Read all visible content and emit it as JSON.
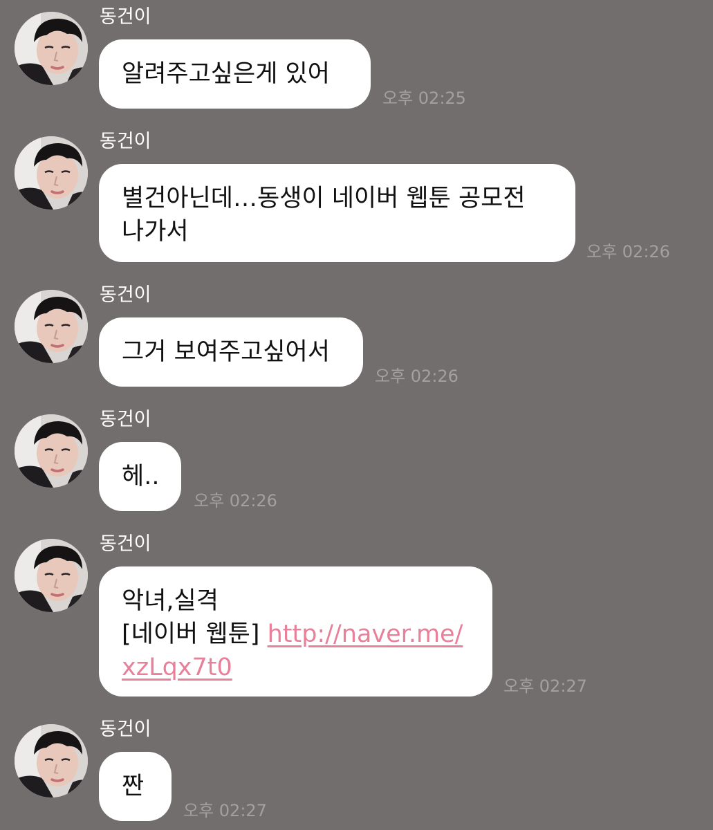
{
  "messages": [
    {
      "sender": "동건이",
      "lines": [
        "알려주고싶은게 있어"
      ],
      "time": "오후 02:25"
    },
    {
      "sender": "동건이",
      "lines": [
        "별건아닌데…동생이 네이버 웹툰 공모전",
        "나가서"
      ],
      "time": "오후 02:26"
    },
    {
      "sender": "동건이",
      "lines": [
        "그거 보여주고싶어서"
      ],
      "time": "오후 02:26"
    },
    {
      "sender": "동건이",
      "lines": [
        "헤.."
      ],
      "time": "오후 02:26"
    },
    {
      "sender": "동건이",
      "lines": [
        "악녀,실격"
      ],
      "prefix": "[네이버 웹툰] ",
      "link_line1": "http://naver.me/",
      "link_line2": "xzLqx7t0",
      "time": "오후 02:27"
    },
    {
      "sender": "동건이",
      "lines": [
        "짠"
      ],
      "time": "오후 02:27"
    }
  ],
  "colors": {
    "background": "#726e6e",
    "bubble": "#ffffff",
    "link": "#e8809a",
    "timestamp": "#a5a0a0"
  }
}
